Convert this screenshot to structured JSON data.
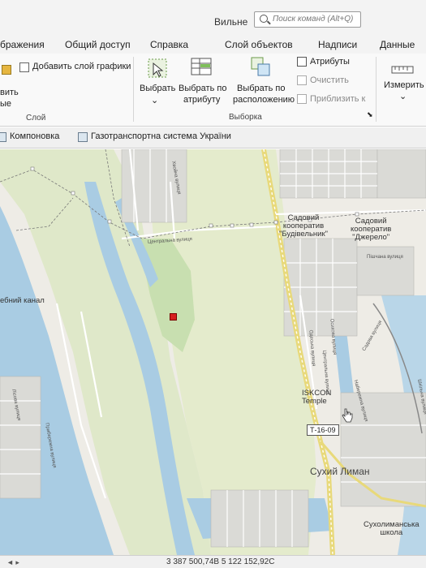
{
  "titlebar": {
    "title": "Вильне",
    "search_placeholder": "Поиск команд (Alt+Q)"
  },
  "tabs": [
    {
      "label": "бражения"
    },
    {
      "label": "Общий доступ"
    },
    {
      "label": "Справка"
    },
    {
      "label": "Слой объектов"
    },
    {
      "label": "Надписи"
    },
    {
      "label": "Данные"
    }
  ],
  "ribbon": {
    "add_graphics_layer": "Добавить слой графики",
    "left_partial_1": "вить",
    "left_partial_2": "ые",
    "layer_group": "Слой",
    "select": "Выбрать",
    "select_by_attr_1": "Выбрать по",
    "select_by_attr_2": "атрибуту",
    "select_by_loc_1": "Выбрать по",
    "select_by_loc_2": "расположению",
    "attributes": "Атрибуты",
    "clear": "Очистить",
    "zoom_to": "Приблизить к",
    "selection_group": "Выборка",
    "measure": "Измерить"
  },
  "view_tabs": [
    {
      "label": "Компоновка"
    },
    {
      "label": "Газотранспортна система України"
    }
  ],
  "map": {
    "labels": {
      "garden1_l1": "Садовий",
      "garden1_l2": "кооператив",
      "garden1_l3": "\"Будівельник\"",
      "garden2_l1": "Садовий",
      "garden2_l2": "кооператив",
      "garden2_l3": "\"Джерело\"",
      "canal": "ебний канал",
      "iskcon_l1": "ISKCON",
      "iskcon_l2": "Temple",
      "road_sign": "Т-16-09",
      "town": "Сухий Лиман",
      "school_l1": "Сухолиманська",
      "school_l2": "школа",
      "street_central": "Центральна вулиця",
      "street_pishchana": "Пiшчана вулиця",
      "street_khvoina": "Хвойна вулиця",
      "street_odeska": "Одеська вулиця",
      "street_central2": "Центральна вулиця",
      "street_osynova": "Осикова вулиця",
      "street_sadova": "Садова вулиця",
      "street_naberezhna": "Набережна вулиця",
      "street_lisova": "Лiсова вулиця",
      "street_pryberezhna": "Прибережна вулиця",
      "street_shkilna": "Шкiльна вулиця"
    }
  },
  "statusbar": {
    "coordinates": "3 387 500,74В 5 122 152,92С"
  },
  "colors": {
    "water": "#a9cce3",
    "park": "#c8dfb0",
    "land": "#eeece6",
    "railway": "#d9d27a"
  }
}
